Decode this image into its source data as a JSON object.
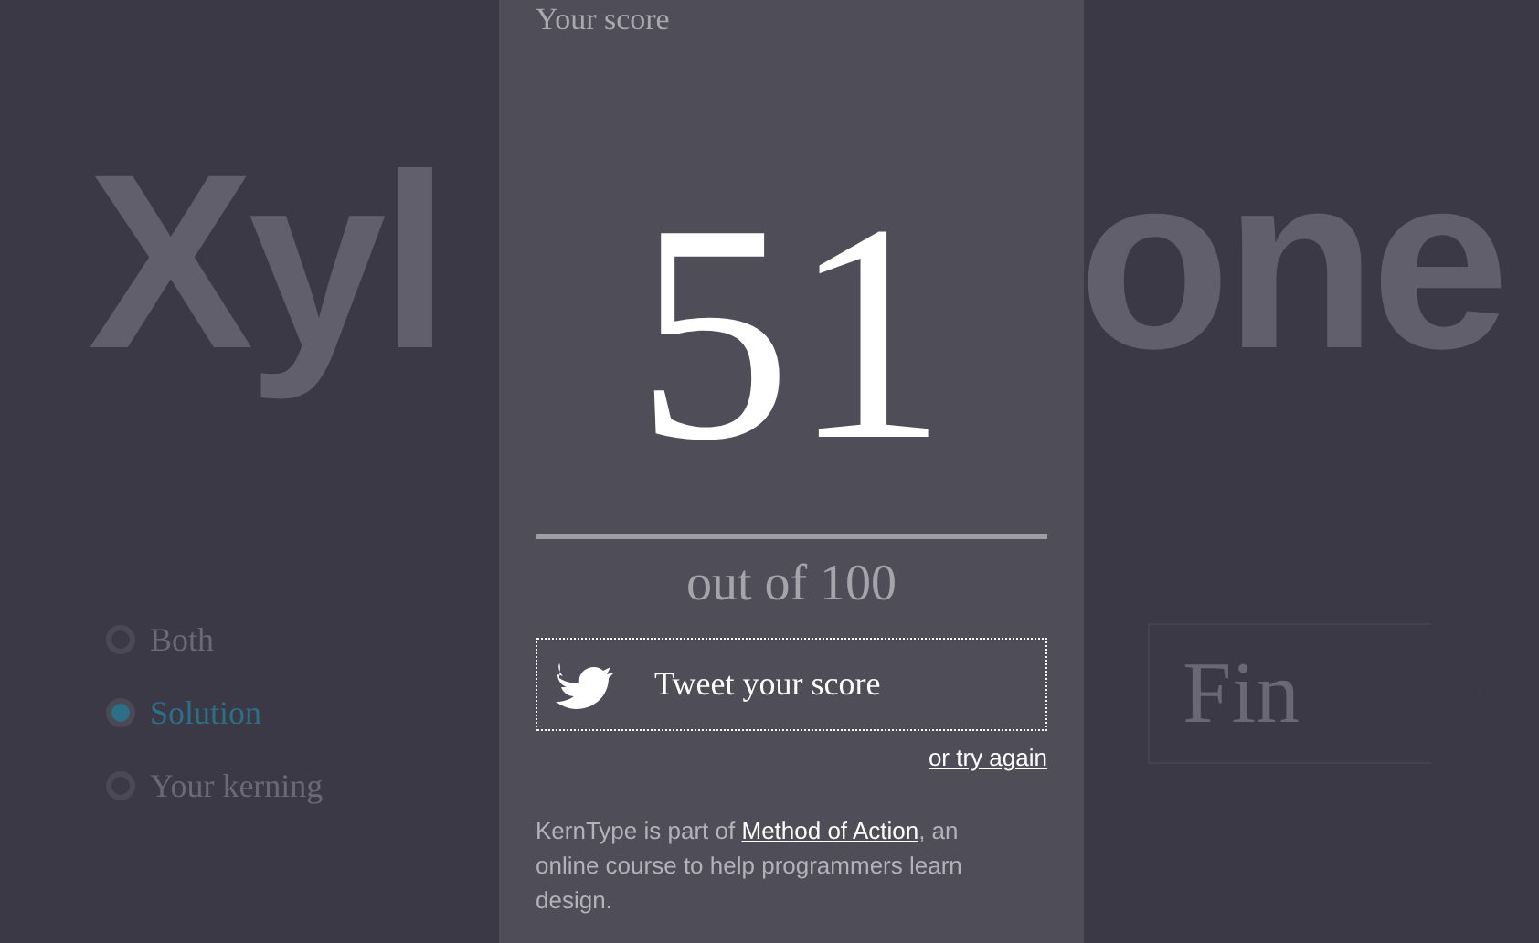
{
  "background_word": {
    "left_part": "Xyl",
    "right_part": "one"
  },
  "view_options": [
    {
      "label": "Both",
      "selected": false
    },
    {
      "label": "Solution",
      "selected": true
    },
    {
      "label": "Your kerning",
      "selected": false
    }
  ],
  "finish_button": {
    "label": "Fin"
  },
  "score_panel": {
    "heading": "Your score",
    "score": "51",
    "out_of": "out of 100",
    "tweet_button": "Tweet your score",
    "try_again_link": "or try again",
    "footer": {
      "before": "KernType is part of ",
      "link": "Method of Action",
      "after": ", an online course to help programmers learn design."
    }
  }
}
